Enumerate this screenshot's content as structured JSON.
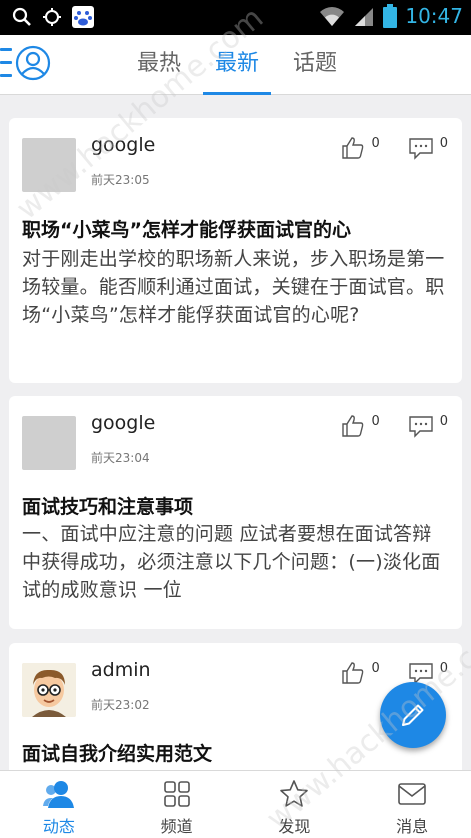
{
  "statusbar": {
    "time": "10:47",
    "icons": [
      "search-icon",
      "location-icon",
      "baidu-icon",
      "wifi-icon",
      "signal-icon",
      "battery-icon"
    ]
  },
  "header": {
    "tabs": [
      {
        "label": "最热",
        "active": false
      },
      {
        "label": "最新",
        "active": true
      },
      {
        "label": "话题",
        "active": false
      }
    ],
    "accent_color": "#1e88e5"
  },
  "feed": {
    "posts": [
      {
        "author": "google",
        "time": "前天23:05",
        "likes": "0",
        "comments": "0",
        "title": "职场“小菜鸟”怎样才能俘获面试官的心",
        "body": "对于刚走出学校的职场新人来说，步入职场是第一场较量。能否顺利通过面试，关键在于面试官。职场“小菜鸟”怎样才能俘获面试官的心呢?",
        "avatar": "placeholder"
      },
      {
        "author": "google",
        "time": "前天23:04",
        "likes": "0",
        "comments": "0",
        "title": "面试技巧和注意事项",
        "body": "一、面试中应注意的问题 应试者要想在面试答辩中获得成功，必须注意以下几个问题：(一)淡化面试的成败意识 一位",
        "avatar": "placeholder"
      },
      {
        "author": "admin",
        "time": "前天23:02",
        "likes": "0",
        "comments": "0",
        "title": "面试自我介绍实用范文",
        "body": "",
        "avatar": "cartoon-man"
      }
    ]
  },
  "fab": {
    "icon": "pencil-icon"
  },
  "bottom_nav": {
    "items": [
      {
        "label": "动态",
        "icon": "people-icon",
        "active": true
      },
      {
        "label": "频道",
        "icon": "grid-icon",
        "active": false
      },
      {
        "label": "发现",
        "icon": "star-icon",
        "active": false
      },
      {
        "label": "消息",
        "icon": "envelope-icon",
        "active": false
      }
    ]
  },
  "watermark": {
    "text": "www.hackhome.com"
  }
}
